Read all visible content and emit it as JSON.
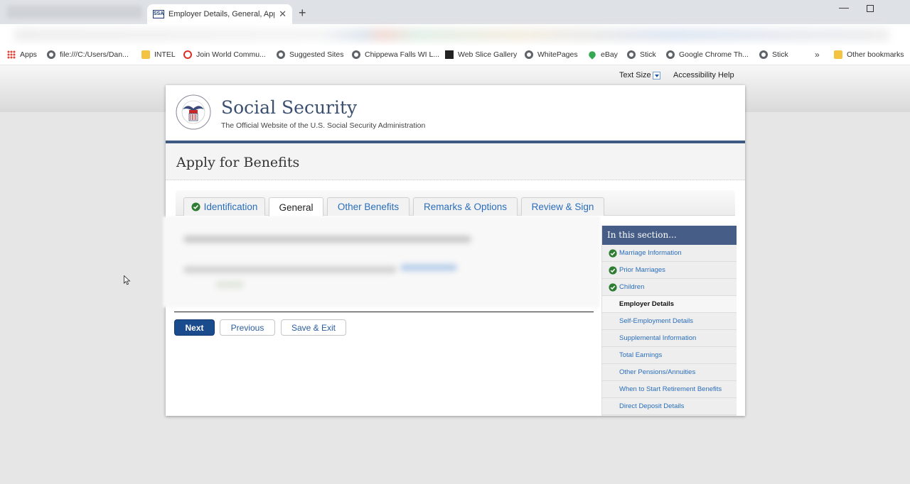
{
  "browser": {
    "tab_title": "Employer Details, General, Apply",
    "tab_favicon": "SSA",
    "tab_close": "✕",
    "new_tab": "+",
    "bookmarks": [
      {
        "label": "Apps",
        "icon": "apps-icon"
      },
      {
        "label": "file:///C:/Users/Dan...",
        "icon": "globe-icon"
      },
      {
        "label": "INTEL",
        "icon": "folder-icon"
      },
      {
        "label": "Join World Commu...",
        "icon": "community-icon"
      },
      {
        "label": "Suggested Sites",
        "icon": "globe-icon"
      },
      {
        "label": "Chippewa Falls WI L...",
        "icon": "globe-icon"
      },
      {
        "label": "Web Slice Gallery",
        "icon": "web-slice-icon"
      },
      {
        "label": "WhitePages",
        "icon": "globe-icon"
      },
      {
        "label": "eBay",
        "icon": "map-pin-icon"
      },
      {
        "label": "Stick",
        "icon": "globe-icon"
      },
      {
        "label": "Google Chrome Th...",
        "icon": "globe-icon"
      },
      {
        "label": "Stick",
        "icon": "globe-icon"
      }
    ],
    "more_bookmarks": "»",
    "other_bookmarks": "Other bookmarks"
  },
  "utility": {
    "text_size": "Text Size",
    "accessibility_help": "Accessibility Help"
  },
  "site": {
    "title": "Social Security",
    "tagline": "The Official Website of the U.S. Social Security Administration",
    "page_title": "Apply for Benefits"
  },
  "tabs": [
    {
      "label": "Identification",
      "completed": true
    },
    {
      "label": "General",
      "active": true
    },
    {
      "label": "Other Benefits"
    },
    {
      "label": "Remarks & Options"
    },
    {
      "label": "Review & Sign"
    }
  ],
  "buttons": {
    "next": "Next",
    "previous": "Previous",
    "save_exit": "Save & Exit"
  },
  "section_nav": {
    "heading": "In this section...",
    "items": [
      {
        "label": "Marriage Information",
        "completed": true
      },
      {
        "label": "Prior Marriages",
        "completed": true
      },
      {
        "label": "Children",
        "completed": true
      },
      {
        "label": "Employer Details",
        "current": true
      },
      {
        "label": "Self-Employment Details"
      },
      {
        "label": "Supplemental Information"
      },
      {
        "label": "Total Earnings"
      },
      {
        "label": "Other Pensions/Annuities"
      },
      {
        "label": "When to Start Retirement Benefits"
      },
      {
        "label": "Direct Deposit Details"
      }
    ]
  },
  "colors": {
    "brand_bar": "#3f5a82",
    "primary_button": "#1a4b8c",
    "link": "#2a6ebb",
    "check_green": "#2e7d32"
  }
}
